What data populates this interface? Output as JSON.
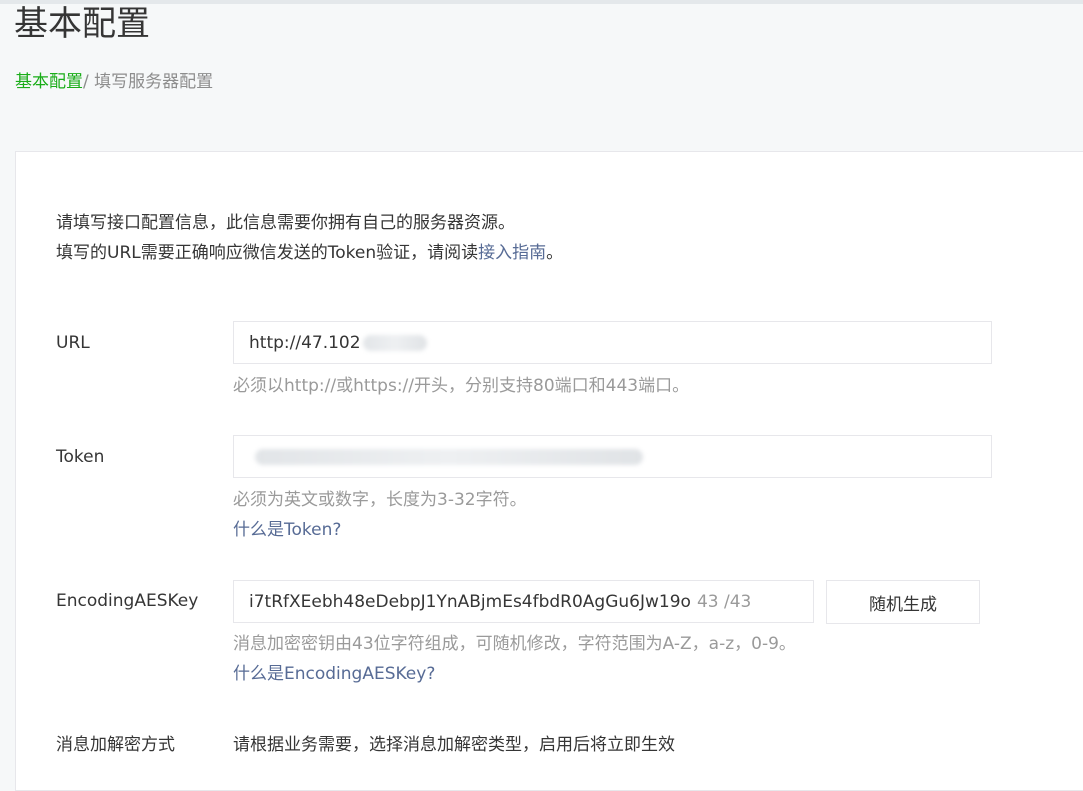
{
  "page": {
    "title": "基本配置",
    "breadcrumb": {
      "root": "基本配置",
      "separator": "/ ",
      "current": "填写服务器配置"
    }
  },
  "intro": {
    "line1": "请填写接口配置信息，此信息需要你拥有自己的服务器资源。",
    "line2_prefix": "填写的URL需要正确响应微信发送的Token验证，请阅读",
    "line2_link": "接入指南",
    "line2_suffix": "。"
  },
  "url_field": {
    "label": "URL",
    "value": "http://47.102",
    "tip": "必须以http://或https://开头，分别支持80端口和443端口。"
  },
  "token_field": {
    "label": "Token",
    "tip": "必须为英文或数字，长度为3-32字符。",
    "help_link": "什么是Token?"
  },
  "aes_field": {
    "label": "EncodingAESKey",
    "value": "i7tRfXEebh48eDebpJ1YnABjmEs4fbdR0AgGu6Jw19o",
    "counter": "43 /43",
    "generate_button": "随机生成",
    "tip": "消息加密密钥由43位字符组成，可随机修改，字符范围为A-Z，a-z，0-9。",
    "help_link": "什么是EncodingAESKey?"
  },
  "encrypt_mode": {
    "label": "消息加解密方式",
    "description": "请根据业务需要，选择消息加解密类型，启用后将立即生效"
  },
  "colors": {
    "accent_green": "#1aad19",
    "link_blue": "#576b95",
    "tip_gray": "#9a9a9a",
    "border": "#e7e7eb"
  }
}
